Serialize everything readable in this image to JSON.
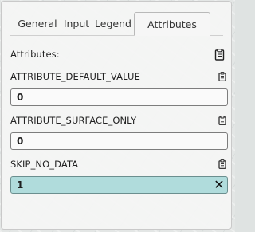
{
  "tabs": [
    {
      "label": "General"
    },
    {
      "label": "Input"
    },
    {
      "label": "Legend"
    },
    {
      "label": "Attributes",
      "active": true
    }
  ],
  "attributes_header": "Attributes:",
  "fields": [
    {
      "name": "ATTRIBUTE_DEFAULT_VALUE",
      "value": "0"
    },
    {
      "name": "ATTRIBUTE_SURFACE_ONLY",
      "value": "0"
    },
    {
      "name": "SKIP_NO_DATA",
      "value": "1"
    }
  ],
  "icons": {
    "copy": "clipboard-icon",
    "clear": "clear-icon",
    "clear_glyph": "✕"
  },
  "colors": {
    "active_field": "#b0dcdc",
    "panel": "#f5f5f5"
  }
}
